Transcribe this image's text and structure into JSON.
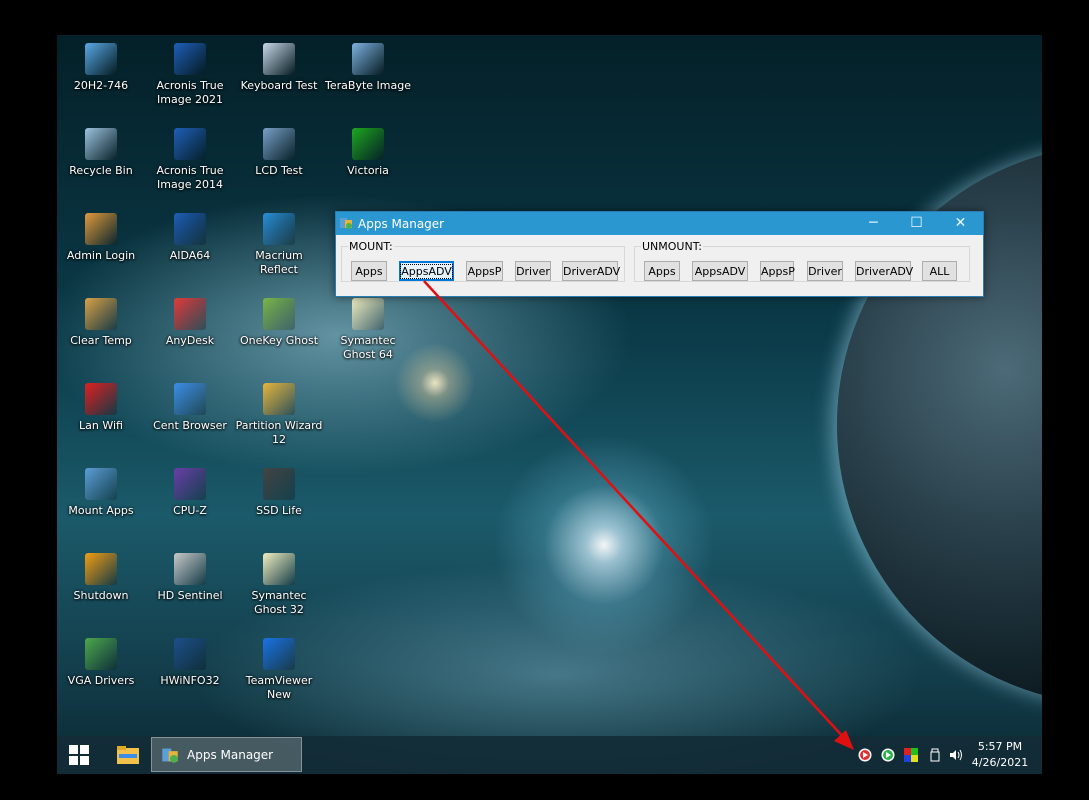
{
  "desktop_icons": [
    {
      "label": "20H2-746",
      "icon": "computer-icon",
      "color": "#5aa9e6"
    },
    {
      "label": "Acronis True Image 2021",
      "icon": "acronis-icon",
      "color": "#1f5fb8"
    },
    {
      "label": "Keyboard Test",
      "icon": "keyboard-test-icon",
      "color": "#c8d8e8"
    },
    {
      "label": "TeraByte Image",
      "icon": "terabyte-icon",
      "color": "#7fb2e0"
    },
    {
      "label": "Recycle Bin",
      "icon": "recycle-bin-icon",
      "color": "#9fc4e0"
    },
    {
      "label": "Acronis True Image 2014",
      "icon": "acronis-icon",
      "color": "#1f5fb8"
    },
    {
      "label": "LCD Test",
      "icon": "laptop-icon",
      "color": "#7aa0c8"
    },
    {
      "label": "Victoria",
      "icon": "green-cross-icon",
      "color": "#1ea81e"
    },
    {
      "label": "Admin Login",
      "icon": "key-icon",
      "color": "#e09a3c"
    },
    {
      "label": "AIDA64",
      "icon": "aida64-icon",
      "color": "#1f5fb8"
    },
    {
      "label": "Macrium Reflect",
      "icon": "macrium-icon",
      "color": "#2a8fd8"
    },
    {
      "label": "Clear Temp",
      "icon": "broom-icon",
      "color": "#d9a34a"
    },
    {
      "label": "AnyDesk",
      "icon": "anydesk-icon",
      "color": "#e23b3b"
    },
    {
      "label": "OneKey Ghost",
      "icon": "onekey-ghost-icon",
      "color": "#7ab648"
    },
    {
      "label": "Symantec Ghost 64",
      "icon": "ghost-icon",
      "color": "#f1eec0"
    },
    {
      "label": "Lan Wifi",
      "icon": "wifi-icon",
      "color": "#e02020"
    },
    {
      "label": "Cent Browser",
      "icon": "cent-browser-icon",
      "color": "#3b8ee8"
    },
    {
      "label": "Partition Wizard 12",
      "icon": "partition-wizard-icon",
      "color": "#e6b43a"
    },
    {
      "label": "Mount Apps",
      "icon": "mount-apps-icon",
      "color": "#5c9ed8"
    },
    {
      "label": "CPU-Z",
      "icon": "cpu-z-icon",
      "color": "#6a3ea8"
    },
    {
      "label": "SSD Life",
      "icon": "ssd-chip-icon",
      "color": "#444444"
    },
    {
      "label": "Shutdown",
      "icon": "power-icon",
      "color": "#f39c12"
    },
    {
      "label": "HD Sentinel",
      "icon": "hdd-sentinel-icon",
      "color": "#c8c8c8"
    },
    {
      "label": "Symantec Ghost 32",
      "icon": "ghost-icon",
      "color": "#f1eec0"
    },
    {
      "label": "VGA Drivers",
      "icon": "vga-card-icon",
      "color": "#4ca84c"
    },
    {
      "label": "HWiNFO32",
      "icon": "hwinfo-icon",
      "color": "#1c4e8a"
    },
    {
      "label": "TeamViewer New",
      "icon": "teamviewer-icon",
      "color": "#1a73e8"
    }
  ],
  "window": {
    "title": "Apps Manager",
    "minimize": "─",
    "maximize": "☐",
    "close": "✕",
    "mount": {
      "legend": "MOUNT:",
      "buttons": [
        "Apps",
        "AppsADV",
        "AppsP",
        "Driver",
        "DriverADV"
      ],
      "focused": "AppsADV"
    },
    "unmount": {
      "legend": "UNMOUNT:",
      "buttons": [
        "Apps",
        "AppsADV",
        "AppsP",
        "Driver",
        "DriverADV",
        "ALL"
      ]
    }
  },
  "taskbar": {
    "app_label": "Apps Manager",
    "clock_time": "5:57 PM",
    "clock_date": "4/26/2021",
    "tray_icons": [
      "red-play-icon",
      "green-play-icon",
      "color-grid-icon",
      "usb-drive-icon",
      "volume-icon"
    ]
  },
  "colors": {
    "titlebar": "#2b97d0",
    "arrow": "#e01010",
    "focus": "#0078d7"
  }
}
